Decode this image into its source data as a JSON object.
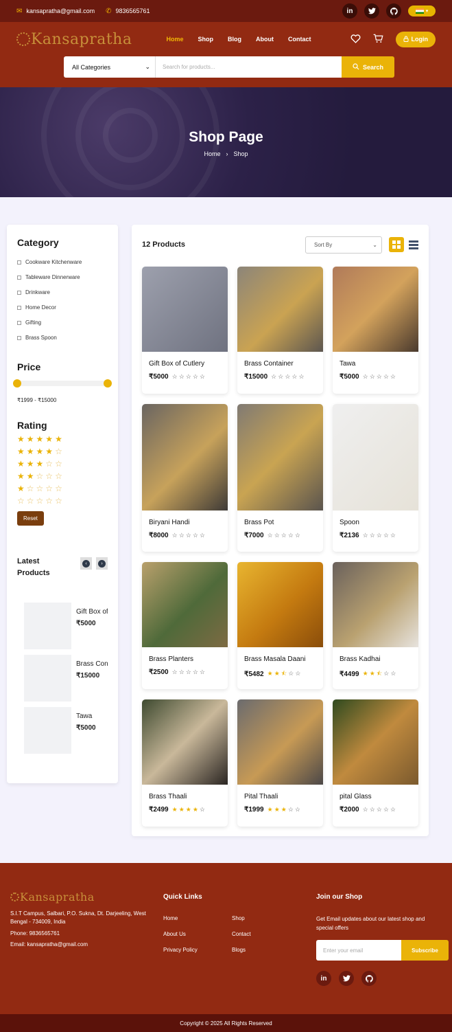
{
  "topbar": {
    "email": "kansapratha@gmail.com",
    "phone": "9836565761",
    "social_icons": [
      "linkedin-icon",
      "twitter-icon",
      "github-icon"
    ]
  },
  "header": {
    "logo": "Kansapratha",
    "menu": [
      "Home",
      "Shop",
      "Blog",
      "About",
      "Contact"
    ],
    "active_menu": "Home",
    "login_label": "Login",
    "accent_color": "#eab308",
    "brand_color": "#922a12"
  },
  "search": {
    "category_value": "All Categories",
    "placeholder": "Search for products...",
    "button_label": "Search"
  },
  "hero": {
    "title": "Shop Page",
    "breadcrumb": [
      "Home",
      "Shop"
    ]
  },
  "sidebar": {
    "category_title": "Category",
    "categories": [
      "Cookware Kitchenware",
      "Tableware Dinnerware",
      "Drinkware",
      "Home Decor",
      "Gifting",
      "Brass Spoon"
    ],
    "price_title": "Price",
    "price_range": "₹1999 - ₹15000",
    "rating_title": "Rating",
    "rating_options": [
      5,
      4,
      3,
      2,
      1,
      0
    ],
    "reset_label": "Reset",
    "latest_title": "Latest Products",
    "latest": [
      {
        "name": "Gift Box of Cutlery",
        "price": "₹5000"
      },
      {
        "name": "Brass Container",
        "price": "₹15000"
      },
      {
        "name": "Tawa",
        "price": "₹5000"
      }
    ]
  },
  "products": {
    "count_label": "12 Products",
    "sort_label": "Sort By",
    "items": [
      {
        "name": "Gift Box of Cutlery",
        "price": "₹5000",
        "rating": 0
      },
      {
        "name": "Brass Container",
        "price": "₹15000",
        "rating": 0
      },
      {
        "name": "Tawa",
        "price": "₹5000",
        "rating": 0
      },
      {
        "name": "Biryani Handi",
        "price": "₹8000",
        "rating": 0
      },
      {
        "name": "Brass Pot",
        "price": "₹7000",
        "rating": 0
      },
      {
        "name": "Spoon",
        "price": "₹2136",
        "rating": 0
      },
      {
        "name": "Brass Planters",
        "price": "₹2500",
        "rating": 0
      },
      {
        "name": "Brass Masala Daani",
        "price": "₹5482",
        "rating": 2.5
      },
      {
        "name": "Brass Kadhai",
        "price": "₹4499",
        "rating": 2.5
      },
      {
        "name": "Brass Thaali",
        "price": "₹2499",
        "rating": 4
      },
      {
        "name": "Pital Thaali",
        "price": "₹1999",
        "rating": 3
      },
      {
        "name": "pital Glass",
        "price": "₹2000",
        "rating": 0
      }
    ]
  },
  "footer": {
    "logo": "Kansapratha",
    "address": "S.I.T Campus, Salbari, P.O. Sukna, Dt. Darjeeling, West Bengal - 734009, India",
    "phone": "Phone: 9836565761",
    "email": "Email: kansapratha@gmail.com",
    "quick_links_title": "Quick Links",
    "links": [
      "Home",
      "Shop",
      "About Us",
      "Contact",
      "Privacy Policy",
      "Blogs"
    ],
    "join_title": "Join our Shop",
    "join_desc": "Get Email updates about our latest shop and special offers",
    "email_placeholder": "Enter your email",
    "subscribe_label": "Subscribe",
    "copyright": "Copyright © 2025 All Rights Reserved"
  }
}
